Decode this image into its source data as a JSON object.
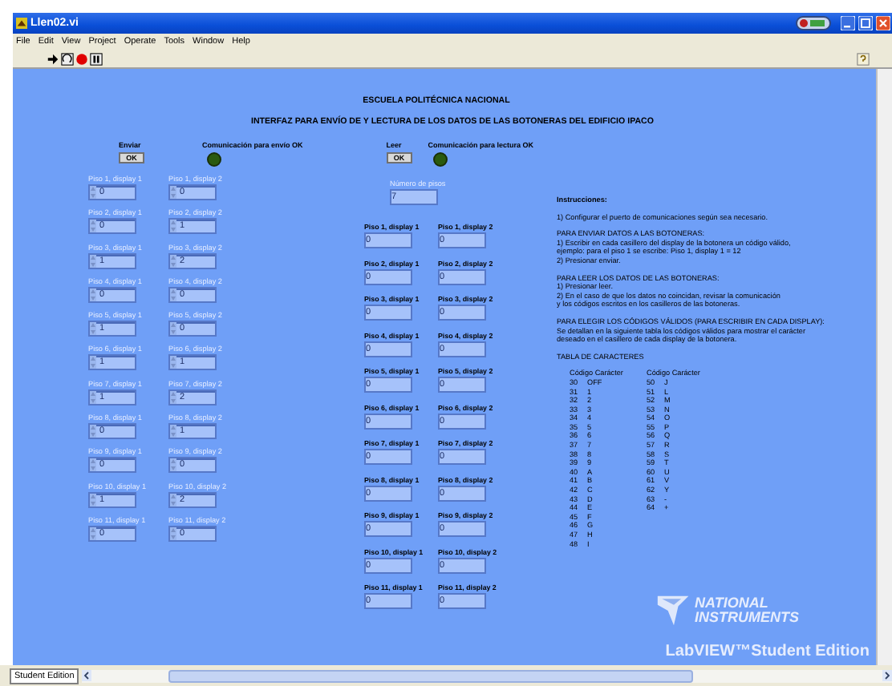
{
  "window": {
    "title": "Llen02.vi"
  },
  "menu": [
    "File",
    "Edit",
    "View",
    "Project",
    "Operate",
    "Tools",
    "Window",
    "Help"
  ],
  "header": {
    "title": "ESCUELA POLITÉCNICA NACIONAL",
    "subtitle": "INTERFAZ PARA ENVÍO DE Y LECTURA DE LOS DATOS DE LAS BOTONERAS DEL EDIFICIO IPACO"
  },
  "send": {
    "label": "Enviar",
    "button": "OK"
  },
  "send_led": {
    "label": "Comunicación para envío OK",
    "on": false
  },
  "read": {
    "label": "Leer",
    "button": "OK"
  },
  "read_led": {
    "label": "Comunicación para lectura OK",
    "on": false
  },
  "send_rows": [
    {
      "display_1": {
        "label": "Piso 1, display 1",
        "value": "0"
      },
      "display_2": {
        "label": "Piso 1, display 2",
        "value": "0"
      }
    },
    {
      "display_1": {
        "label": "Piso 2, display 1",
        "value": "0"
      },
      "display_2": {
        "label": "Piso 2, display 2",
        "value": "1"
      }
    },
    {
      "display_1": {
        "label": "Piso 3, display 1",
        "value": "1"
      },
      "display_2": {
        "label": "Piso 3, display 2",
        "value": "2"
      }
    },
    {
      "display_1": {
        "label": "Piso 4, display 1",
        "value": "0"
      },
      "display_2": {
        "label": "Piso 4, display 2",
        "value": "0"
      }
    },
    {
      "display_1": {
        "label": "Piso 5, display 1",
        "value": "1"
      },
      "display_2": {
        "label": "Piso 5, display 2",
        "value": "0"
      }
    },
    {
      "display_1": {
        "label": "Piso 6, display 1",
        "value": "1"
      },
      "display_2": {
        "label": "Piso 6, display 2",
        "value": "1"
      }
    },
    {
      "display_1": {
        "label": "Piso 7, display 1",
        "value": "1"
      },
      "display_2": {
        "label": "Piso 7, display 2",
        "value": "2"
      }
    },
    {
      "display_1": {
        "label": "Piso 8, display 1",
        "value": "0"
      },
      "display_2": {
        "label": "Piso 8, display 2",
        "value": "1"
      }
    },
    {
      "display_1": {
        "label": "Piso 9, display 1",
        "value": "0"
      },
      "display_2": {
        "label": "Piso 9, display 2",
        "value": "0"
      }
    },
    {
      "display_1": {
        "label": "Piso 10, display 1",
        "value": "1"
      },
      "display_2": {
        "label": "Piso 10, display 2",
        "value": "2"
      }
    },
    {
      "display_1": {
        "label": "Piso 11, display 1",
        "value": "0"
      },
      "display_2": {
        "label": "Piso 11, display 2",
        "value": "0"
      }
    }
  ],
  "floors": {
    "label": "Número de pisos",
    "value": "7"
  },
  "read_rows": [
    {
      "display_1": {
        "label": "Piso 1, display 1",
        "value": "0"
      },
      "display_2": {
        "label": "Piso 1, display 2",
        "value": "0"
      }
    },
    {
      "display_1": {
        "label": "Piso 2, display 1",
        "value": "0"
      },
      "display_2": {
        "label": "Piso 2, display 2",
        "value": "0"
      }
    },
    {
      "display_1": {
        "label": "Piso 3, display 1",
        "value": "0"
      },
      "display_2": {
        "label": "Piso 3, display 2",
        "value": "0"
      }
    },
    {
      "display_1": {
        "label": "Piso 4, display 1",
        "value": "0"
      },
      "display_2": {
        "label": "Piso 4, display 2",
        "value": "0"
      }
    },
    {
      "display_1": {
        "label": "Piso 5, display 1",
        "value": "0"
      },
      "display_2": {
        "label": "Piso 5, display 2",
        "value": "0"
      }
    },
    {
      "display_1": {
        "label": "Piso 6, display 1",
        "value": "0"
      },
      "display_2": {
        "label": "Piso 6, display 2",
        "value": "0"
      }
    },
    {
      "display_1": {
        "label": "Piso 7, display 1",
        "value": "0"
      },
      "display_2": {
        "label": "Piso 7, display 2",
        "value": "0"
      }
    },
    {
      "display_1": {
        "label": "Piso 8, display 1",
        "value": "0"
      },
      "display_2": {
        "label": "Piso 8, display 2",
        "value": "0"
      }
    },
    {
      "display_1": {
        "label": "Piso 9, display 1",
        "value": "0"
      },
      "display_2": {
        "label": "Piso 9, display 2",
        "value": "0"
      }
    },
    {
      "display_1": {
        "label": "Piso 10, display 1",
        "value": "0"
      },
      "display_2": {
        "label": "Piso 10, display 2",
        "value": "0"
      }
    },
    {
      "display_1": {
        "label": "Piso 11, display 1",
        "value": "0"
      },
      "display_2": {
        "label": "Piso 11, display 2",
        "value": "0"
      }
    }
  ],
  "instructions": {
    "title": "Instrucciones:",
    "paragraphs": [
      [
        "1) Configurar el puerto de comunicaciones según sea necesario."
      ],
      [
        "PARA ENVIAR DATOS A LAS BOTONERAS:",
        "1) Escribir en cada casillero del display de la botonera un código válido,",
        "ejemplo: para el piso 1 se escribe: Piso 1, display 1 = 12",
        "2) Presionar enviar."
      ],
      [
        "PARA LEER LOS DATOS DE LAS BOTONERAS:",
        "1) Presionar leer.",
        "2) En el caso de que los datos no coincidan, revisar la comunicación",
        "y los códigos escritos en los casilleros de las botoneras."
      ],
      [
        "PARA ELEGIR LOS CÓDIGOS VÁLIDOS (PARA ESCRIBIR EN CADA DISPLAY):",
        "Se detallan en la siguiente tabla los códigos válidos para mostrar el carácter",
        "deseado en el casillero de cada display de la botonera."
      ],
      [
        "TABLA DE CARACTERES"
      ]
    ]
  },
  "char_table": {
    "headers": [
      "Código Carácter",
      "Código Carácter"
    ],
    "column_1": [
      {
        "code": "30",
        "char": "OFF"
      },
      {
        "code": "31",
        "char": "1"
      },
      {
        "code": "32",
        "char": "2"
      },
      {
        "code": "33",
        "char": "3"
      },
      {
        "code": "34",
        "char": "4"
      },
      {
        "code": "35",
        "char": "5"
      },
      {
        "code": "36",
        "char": "6"
      },
      {
        "code": "37",
        "char": "7"
      },
      {
        "code": "38",
        "char": "8"
      },
      {
        "code": "39",
        "char": "9"
      },
      {
        "code": "40",
        "char": "A"
      },
      {
        "code": "41",
        "char": "B"
      },
      {
        "code": "42",
        "char": "C"
      },
      {
        "code": "43",
        "char": "D"
      },
      {
        "code": "44",
        "char": "E"
      },
      {
        "code": "45",
        "char": "F"
      },
      {
        "code": "46",
        "char": "G"
      },
      {
        "code": "47",
        "char": "H"
      },
      {
        "code": "48",
        "char": "I"
      }
    ],
    "column_2": [
      {
        "code": "50",
        "char": "J"
      },
      {
        "code": "51",
        "char": "L"
      },
      {
        "code": "52",
        "char": "M"
      },
      {
        "code": "53",
        "char": "N"
      },
      {
        "code": "54",
        "char": "O"
      },
      {
        "code": "55",
        "char": "P"
      },
      {
        "code": "56",
        "char": "Q"
      },
      {
        "code": "57",
        "char": "R"
      },
      {
        "code": "58",
        "char": "S"
      },
      {
        "code": "59",
        "char": "T"
      },
      {
        "code": "60",
        "char": "U"
      },
      {
        "code": "61",
        "char": "V"
      },
      {
        "code": "62",
        "char": "Y"
      },
      {
        "code": "63",
        "char": "-"
      },
      {
        "code": "64",
        "char": "+"
      }
    ]
  },
  "branding": {
    "company_1": "NATIONAL",
    "company_2": "INSTRUMENTS",
    "product": "LabVIEW™Student Edition"
  },
  "status_bar": {
    "tab": "Student Edition"
  }
}
